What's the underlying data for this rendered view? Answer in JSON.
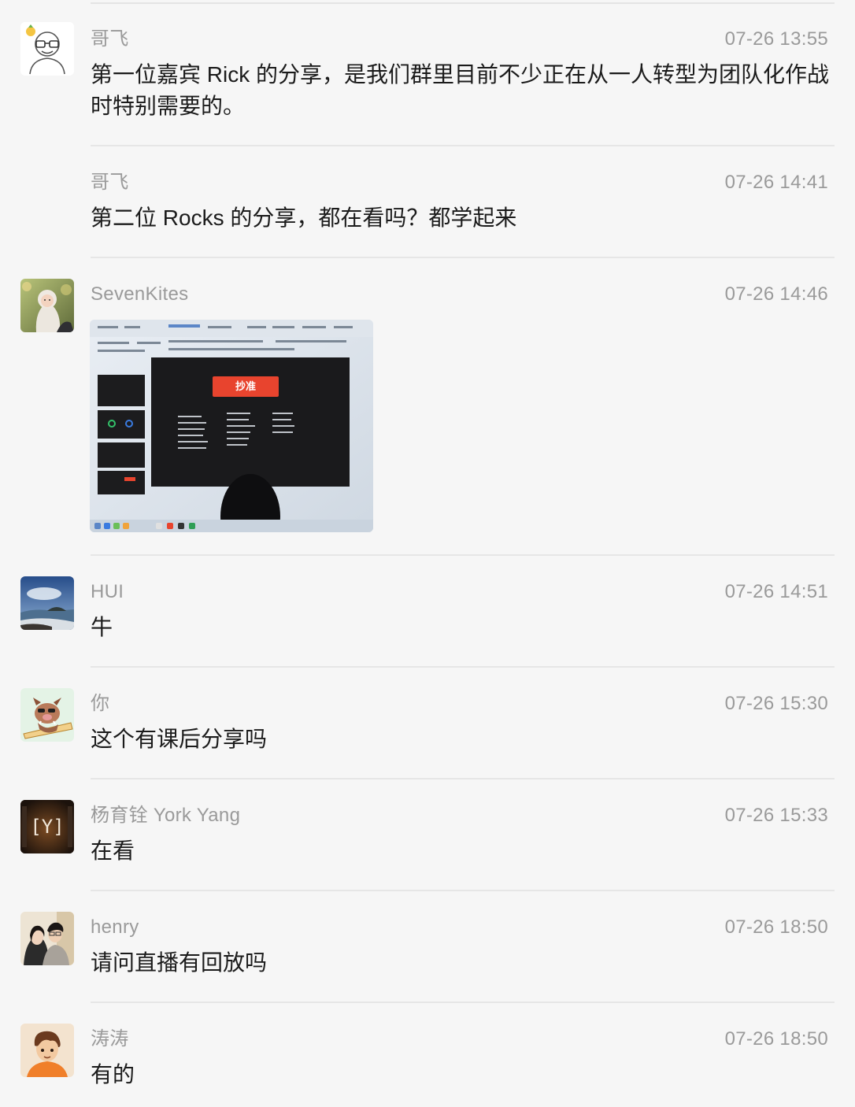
{
  "messages": [
    {
      "name": "哥飞",
      "time": "07-26 13:55",
      "text": "第一位嘉宾 Rick 的分享，是我们群里目前不少正在从一人转型为团队化作战时特别需要的。",
      "avatar": "bald-man-glasses-avatar"
    },
    {
      "name": "哥飞",
      "time": "07-26 14:41",
      "text": "第二位 Rocks 的分享，都在看吗？都学起来"
    },
    {
      "name": "SevenKites",
      "time": "07-26 14:46",
      "image": {
        "label": "抄准",
        "caption": "presentation-slide-photo"
      },
      "avatar": "baby-avatar"
    },
    {
      "name": "HUI",
      "time": "07-26 14:51",
      "text": "牛",
      "avatar": "seaside-avatar"
    },
    {
      "name": "你",
      "time": "07-26 15:30",
      "text": "这个有课后分享吗",
      "avatar": "cartoon-boar-avatar"
    },
    {
      "name": "杨育铨 York Yang",
      "time": "07-26 15:33",
      "text": "在看",
      "avatar": "y-logo-avatar",
      "avatar_text": "[Y]"
    },
    {
      "name": "henry",
      "time": "07-26 18:50",
      "text": "请问直播有回放吗",
      "avatar": "couple-photo-avatar"
    },
    {
      "name": "涛涛",
      "time": "07-26 18:50",
      "text": "有的",
      "avatar": "cartoon-boy-avatar"
    }
  ],
  "colors": {
    "background": "#f6f6f6",
    "meta_text": "#9a9a9a",
    "body_text": "#1b1b1b",
    "slide_label": "#e8442e"
  }
}
